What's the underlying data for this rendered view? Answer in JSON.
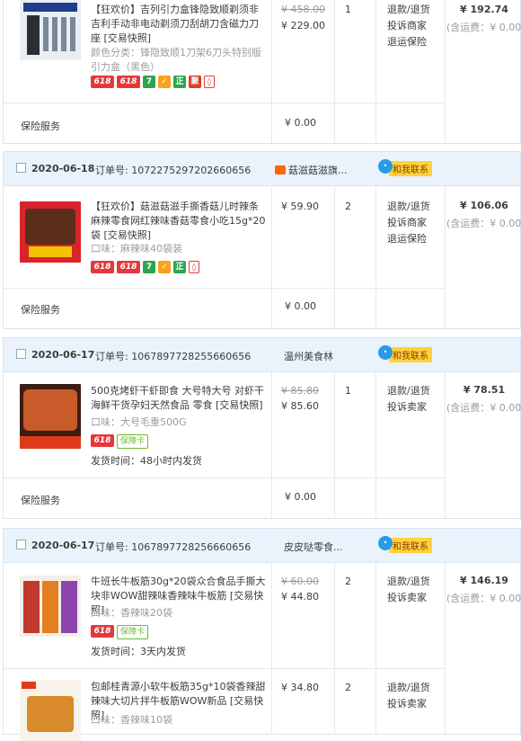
{
  "labels": {
    "order_no_prefix": "订单号:",
    "contact": "和我联系",
    "insurance": "保险服务",
    "insurance_price": "¥ 0.00",
    "ship_fee": "(含运费：¥ 0.00)",
    "action_refund": "退款/退货",
    "action_complain_shop": "投诉商家",
    "action_complain_seller": "投诉卖家",
    "action_return_insurance": "退运保险",
    "ship_time_prefix": "发货时间："
  },
  "orders": [
    {
      "date": "",
      "order_no": "",
      "shop": "",
      "total": "¥ 192.74",
      "items": [
        {
          "title": "【狂欢价】吉列引力盒锋隐致顺剃须非吉利手动非电动剃须刀刮胡刀含磁力刀座 [交易快照]",
          "option": "颜色分类：锋隐致顺1刀架6刀头特别版引力盒（黑色）",
          "old_price": "¥ 458.00",
          "price": "¥ 229.00",
          "qty": "1"
        }
      ]
    },
    {
      "date": "2020-06-18",
      "order_no": "1072275297202660656",
      "shop": "菇滋菇滋旗...",
      "total": "¥ 106.06",
      "items": [
        {
          "title": "【狂欢价】菇滋菇滋手撕香菇儿时辣条麻辣零食网红辣味香菇零食小吃15g*20袋 [交易快照]",
          "option": "口味：麻辣味40袋装",
          "price": "¥ 59.90",
          "qty": "2"
        }
      ]
    },
    {
      "date": "2020-06-17",
      "order_no": "1067897728255660656",
      "shop": "温州美食林",
      "total": "¥ 78.51",
      "items": [
        {
          "title": "500克烤虾干虾即食 大号特大号 对虾干海鲜干货孕妇天然食品 零食 [交易快照]",
          "option": "口味：大号毛重500G",
          "ship_time": "48小时内发货",
          "insurance_tag": "保障卡",
          "old_price": "¥ 85.80",
          "price": "¥ 85.60",
          "qty": "1"
        }
      ]
    },
    {
      "date": "2020-06-17",
      "order_no": "1067897728256660656",
      "shop": "皮皮哒零食...",
      "total": "¥ 146.19",
      "items": [
        {
          "title": "牛班长牛板筋30g*20袋众合食品手撕大块非WOW甜辣味香辣味牛板筋 [交易快照]",
          "option": "口味：香辣味20袋",
          "ship_time": "3天内发货",
          "insurance_tag": "保障卡",
          "old_price": "¥ 60.00",
          "price": "¥ 44.80",
          "qty": "2"
        },
        {
          "title": "包邮桂青源小软牛板筋35g*10袋香辣甜辣味大切片拌牛板筋WOW新品 [交易快照]",
          "option": "口味：香辣味10袋",
          "price": "¥ 34.80",
          "qty": "2"
        }
      ]
    }
  ],
  "tags": {
    "t618": "618",
    "t7": "7",
    "tzheng": "正",
    "tcert": "聚"
  },
  "colors": {
    "header_bg": "#eaf3fb",
    "border": "#d9e4f0",
    "tag_red": "#e4393c",
    "contact_bg": "#ffd33a"
  }
}
